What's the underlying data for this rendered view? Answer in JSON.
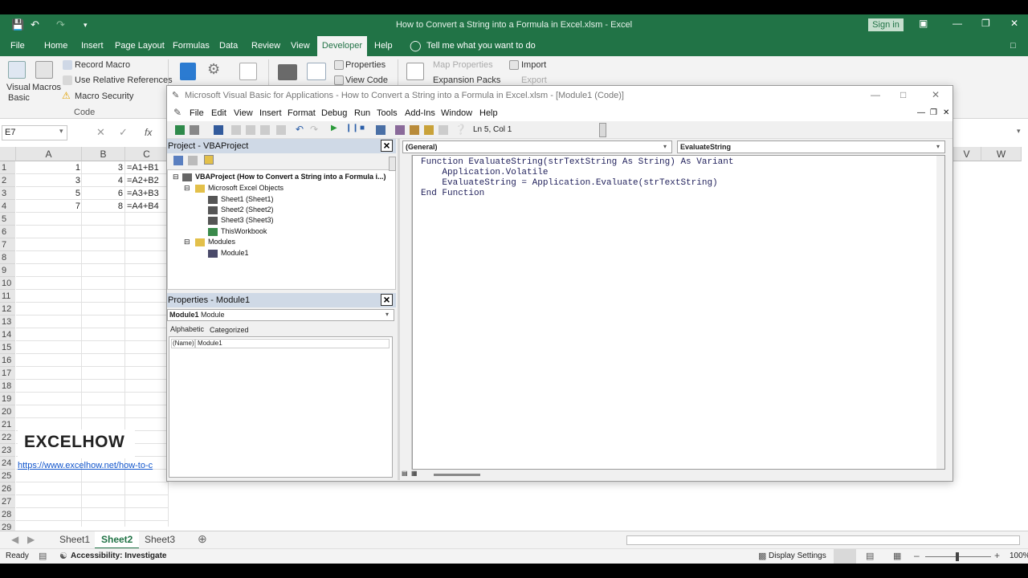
{
  "window": {
    "title": "How to Convert a String into a Formula in Excel.xlsm  -  Excel",
    "sign_in": "Sign in"
  },
  "menu": [
    "File",
    "Home",
    "Insert",
    "Page Layout",
    "Formulas",
    "Data",
    "Review",
    "View",
    "Developer",
    "Help"
  ],
  "tell_me": "Tell me what you want to do",
  "ribbon": {
    "visual_basic": "Visual",
    "visual_basic2": "Basic",
    "macros": "Macros",
    "record_macro": "Record Macro",
    "use_relative": "Use Relative References",
    "macro_security": "Macro Security",
    "group_code": "Code",
    "properties": "Properties",
    "view_code": "View Code",
    "map_properties": "Map Properties",
    "import": "Import",
    "expansion_packs": "Expansion Packs",
    "export": "Export"
  },
  "formula": {
    "namebox": "E7",
    "fx": "fx"
  },
  "columns": [
    "A",
    "B",
    "C",
    "V",
    "W"
  ],
  "cells": [
    {
      "a": "1",
      "b": "3",
      "c": "=A1+B1"
    },
    {
      "a": "3",
      "b": "4",
      "c": "=A2+B2"
    },
    {
      "a": "5",
      "b": "6",
      "c": "=A3+B3"
    },
    {
      "a": "7",
      "b": "8",
      "c": "=A4+B4"
    }
  ],
  "rows": [
    "1",
    "2",
    "3",
    "4",
    "5",
    "6",
    "7",
    "8",
    "9",
    "10",
    "11",
    "12",
    "13",
    "14",
    "15",
    "16",
    "17",
    "18",
    "19",
    "20",
    "21",
    "22",
    "23",
    "24",
    "25",
    "26",
    "27",
    "28",
    "29"
  ],
  "watermark": "EXCELHOW",
  "link": "https://www.excelhow.net/how-to-c",
  "sheets": [
    "Sheet1",
    "Sheet2",
    "Sheet3"
  ],
  "status": {
    "ready": "Ready",
    "accessibility": "Accessibility: Investigate",
    "display": "Display Settings",
    "zoom": "100%"
  },
  "vbe": {
    "title": "Microsoft Visual Basic for Applications - How to Convert a String into a Formula in Excel.xlsm - [Module1 (Code)]",
    "menu": [
      "File",
      "Edit",
      "View",
      "Insert",
      "Format",
      "Debug",
      "Run",
      "Tools",
      "Add-Ins",
      "Window",
      "Help"
    ],
    "position": "Ln 5, Col 1",
    "project_title": "Project - VBAProject",
    "tree": {
      "root": "VBAProject (How to Convert a String into a Formula i...)",
      "objects": "Microsoft Excel Objects",
      "s1": "Sheet1 (Sheet1)",
      "s2": "Sheet2 (Sheet2)",
      "s3": "Sheet3 (Sheet3)",
      "wb": "ThisWorkbook",
      "modules": "Modules",
      "m1": "Module1"
    },
    "props_title": "Properties - Module1",
    "props_combo_bold": "Module1",
    "props_combo_type": "Module",
    "tab_alpha": "Alphabetic",
    "tab_cat": "Categorized",
    "prop_name": "(Name)",
    "prop_value": "Module1",
    "combo_general": "(General)",
    "combo_proc": "EvaluateString",
    "code": [
      "Function EvaluateString(strTextString As String) As Variant",
      "    Application.Volatile",
      "    EvaluateString = Application.Evaluate(strTextString)",
      "End Function"
    ]
  }
}
